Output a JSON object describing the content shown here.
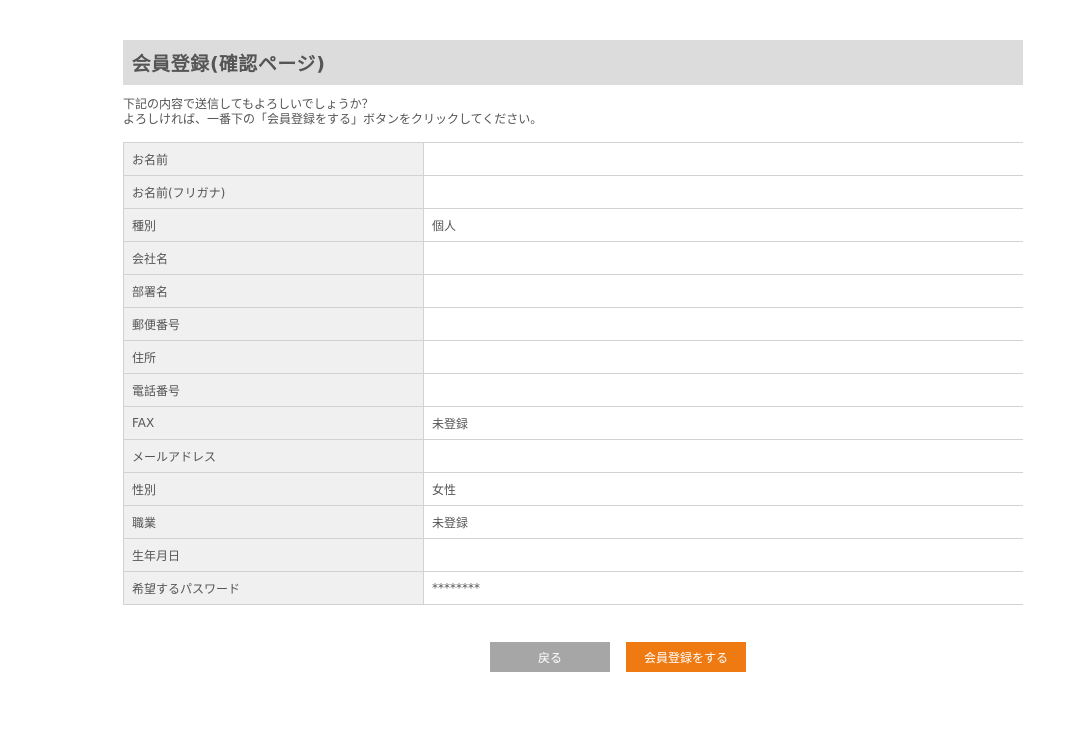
{
  "header": {
    "title": "会員登録(確認ページ)"
  },
  "intro": {
    "line1": "下記の内容で送信してもよろしいでしょうか？",
    "line2": "よろしければ、一番下の「会員登録をする」ボタンをクリックしてください。"
  },
  "fields": [
    {
      "label": "お名前",
      "value": ""
    },
    {
      "label": "お名前(フリガナ)",
      "value": ""
    },
    {
      "label": "種別",
      "value": "個人"
    },
    {
      "label": "会社名",
      "value": ""
    },
    {
      "label": "部署名",
      "value": ""
    },
    {
      "label": "郵便番号",
      "value": ""
    },
    {
      "label": "住所",
      "value": ""
    },
    {
      "label": "電話番号",
      "value": ""
    },
    {
      "label": "FAX",
      "value": "未登録"
    },
    {
      "label": "メールアドレス",
      "value": ""
    },
    {
      "label": "性別",
      "value": "女性"
    },
    {
      "label": "職業",
      "value": "未登録"
    },
    {
      "label": "生年月日",
      "value": ""
    },
    {
      "label": "希望するパスワード",
      "value": "********"
    }
  ],
  "buttons": {
    "back_label": "戻る",
    "submit_label": "会員登録をする"
  },
  "colors": {
    "header_bg": "#dcdcdc",
    "label_bg": "#f0f0f0",
    "back_button": "#a6a6a6",
    "submit_button": "#ef7a12"
  }
}
